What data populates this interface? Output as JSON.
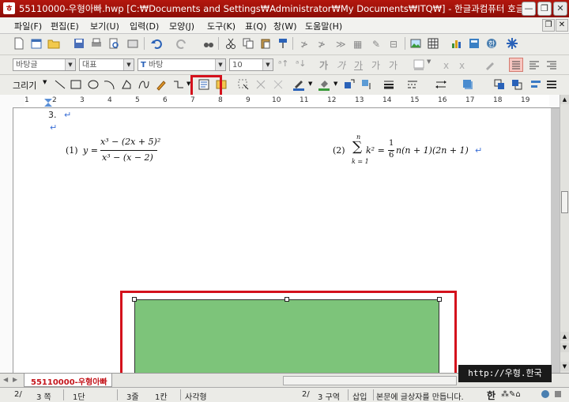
{
  "window": {
    "title": "55110000-우형아빠.hwp [C:₩Documents and Settings₩Administrator₩My Documents₩ITQ₩] - 한글과컴퓨터 호글",
    "minimize_glyph": "—",
    "restore_glyph": "❐",
    "close_glyph": "✕"
  },
  "menu": {
    "items": [
      "파일(F)",
      "편집(E)",
      "보기(U)",
      "입력(D)",
      "모양(J)",
      "도구(K)",
      "표(Q)",
      "창(W)",
      "도움말(H)"
    ],
    "restore_glyph": "❐",
    "close_glyph": "✕"
  },
  "format_bar": {
    "style_value": "바탕글",
    "font_lang_value": "대표",
    "font_value": "바탕",
    "size_value": "10",
    "font_prefix": "T",
    "letters": [
      "가",
      "가",
      "가",
      "가",
      "가"
    ]
  },
  "drawing_bar": {
    "label": "그리기"
  },
  "ruler": {
    "numbers": [
      "1",
      "2",
      "3",
      "4",
      "5",
      "6",
      "7",
      "8",
      "9",
      "10",
      "11",
      "12",
      "13",
      "14",
      "15",
      "16",
      "17",
      "18",
      "19"
    ]
  },
  "document": {
    "item_number": "3.",
    "eq1_label": "(1)",
    "eq1_lhs": "y =",
    "eq1_numerator": "x³ − (2x + 5)²",
    "eq1_denominator": "x³ − (x − 2)",
    "eq2_label": "(2)",
    "eq2_sum_top": "n",
    "eq2_sum_bottom": "k = 1",
    "eq2_term": "k² =",
    "eq2_frac_num": "1",
    "eq2_frac_den": "6",
    "eq2_rhs": "n(n + 1)(2n + 1)",
    "paragraph_mark": "↵",
    "shape_color": "#7dc47a",
    "highlight_color": "#d4111c"
  },
  "tab_bar": {
    "active_tab": "55110000-우형아빠"
  },
  "status_bar": {
    "page": "2/",
    "total_pages": "3 쪽",
    "column": "1단",
    "line": "3줄",
    "col": "1칸",
    "object": "사각형",
    "section": "2/",
    "total_sections": "3 구역",
    "insert_mode": "삽입",
    "message": "본문에 글상자를 만듭니다.",
    "ime": "한"
  },
  "watermark": {
    "text": "http://우형.한국"
  }
}
